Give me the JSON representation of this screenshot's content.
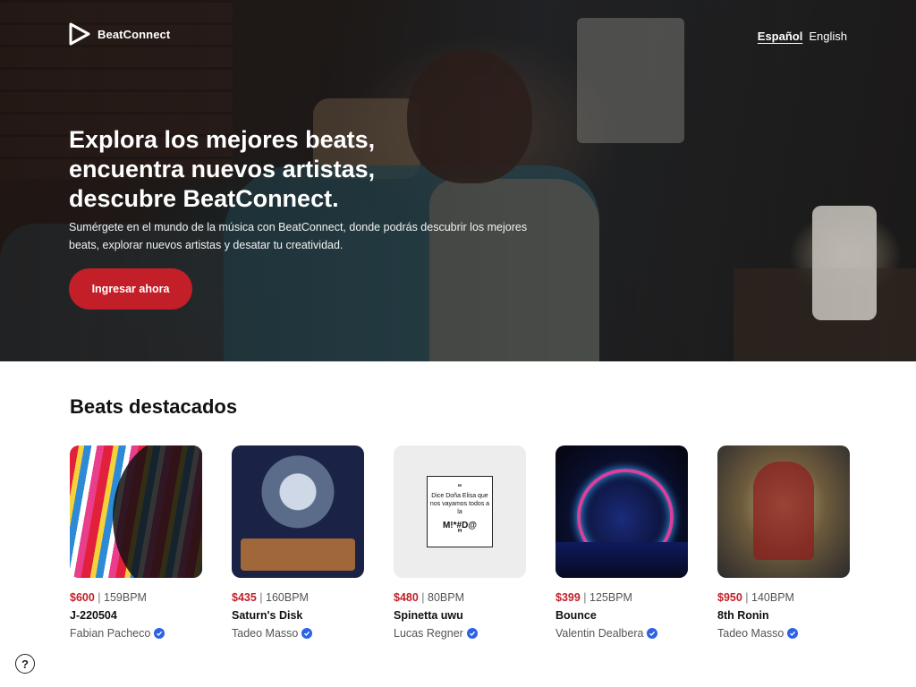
{
  "brand": {
    "name": "BeatConnect",
    "logo_icon": "play-triangle-icon"
  },
  "nav": {
    "languages": [
      {
        "label": "Español",
        "active": true
      },
      {
        "label": "English",
        "active": false
      }
    ]
  },
  "hero": {
    "title_line1": "Explora los mejores beats,",
    "title_line2": "encuentra nuevos artistas,",
    "title_line3": "descubre BeatConnect.",
    "description": "Sumérgete en el mundo de la música con BeatConnect, donde podrás descubrir los mejores beats, explorar nuevos artistas y desatar tu creatividad.",
    "cta_label": "Ingresar ahora"
  },
  "featured": {
    "title_light": "Beats",
    "title_bold": "destacados",
    "beats": [
      {
        "price": "$600",
        "separator": "|",
        "bpm": "159BPM",
        "name": "J-220504",
        "author": "Fabian Pacheco",
        "verified": true
      },
      {
        "price": "$435",
        "separator": "|",
        "bpm": "160BPM",
        "name": "Saturn's Disk",
        "author": "Tadeo Masso",
        "verified": true
      },
      {
        "price": "$480",
        "separator": "|",
        "bpm": "80BPM",
        "name": "Spinetta uwu",
        "author": "Lucas Regner",
        "verified": true
      },
      {
        "price": "$399",
        "separator": "|",
        "bpm": "125BPM",
        "name": "Bounce",
        "author": "Valentin Dealbera",
        "verified": true
      },
      {
        "price": "$950",
        "separator": "|",
        "bpm": "140BPM",
        "name": "8th Ronin",
        "author": "Tadeo Masso",
        "verified": true
      }
    ],
    "quote_art": {
      "open_quote": "“",
      "text": "Dice Doña Elisa que nos vayamos todos a la",
      "big": "M!*#D@",
      "close_quote": "”"
    }
  },
  "help": {
    "label": "?"
  },
  "colors": {
    "accent": "#c31f28",
    "verified": "#2b62e6"
  }
}
